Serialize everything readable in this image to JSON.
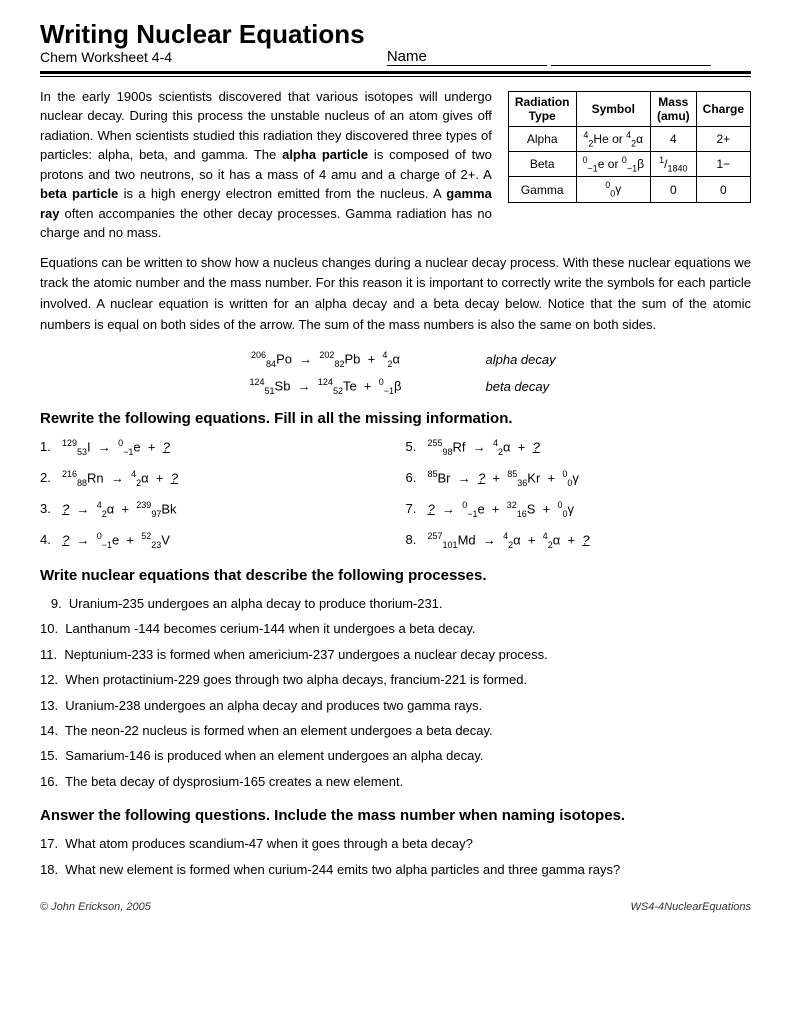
{
  "header": {
    "title": "Writing Nuclear Equations",
    "subtitle": "Chem Worksheet 4-4",
    "name_label": "Name"
  },
  "intro": {
    "paragraph1": "In the early 1900s scientists discovered that various isotopes will undergo nuclear decay. During this process the unstable nucleus of an atom gives off radiation. When scientists studied this radiation they discovered three types of particles: alpha, beta, and gamma. The ",
    "alpha_bold": "alpha particle",
    "paragraph1b": " is composed of two protons and two neutrons, so it has a mass of 4 amu and a charge of 2+. A ",
    "beta_bold": "beta particle",
    "paragraph1c": " is a high energy electron emitted from the nucleus. A ",
    "gamma_bold": "gamma ray",
    "paragraph1d": " often accompanies the other decay processes. Gamma radiation has no charge and no mass.",
    "paragraph2": "Equations can be written to show how a nucleus changes during a nuclear decay process. With these nuclear equations we track the atomic number and the mass number. For this reason it is important to correctly write the symbols for each particle involved. A nuclear equation is written for an alpha decay and a beta decay below. Notice that the sum of the atomic numbers is equal on both sides of the arrow. The sum of the mass numbers is also the same on both sides."
  },
  "radiation_table": {
    "headers": [
      "Radiation Type",
      "Symbol",
      "Mass (amu)",
      "Charge"
    ],
    "rows": [
      [
        "Alpha",
        "⁴₂He or ⁴₂α",
        "4",
        "2+"
      ],
      [
        "Beta",
        "⁰₋₁e or ⁰₋₁β",
        "1/1840",
        "1−"
      ],
      [
        "Gamma",
        "⁰₀γ",
        "0",
        "0"
      ]
    ]
  },
  "example_equations": {
    "alpha": {
      "equation": "²⁰⁶₈₄Po → ²⁰²₈₂Pb + ⁴₂α",
      "label": "alpha decay"
    },
    "beta": {
      "equation": "¹²⁴₅₁Sb → ¹²⁴₅₂Te + ⁰₋₁β",
      "label": "beta decay"
    }
  },
  "section1": {
    "title": "Rewrite the following equations. Fill in all the missing information.",
    "problems": [
      {
        "num": "1.",
        "eq": "¹²⁹₅₃I → ⁰₋₁e + ?"
      },
      {
        "num": "2.",
        "eq": "²¹⁶₈₈Rn → ⁴₂α + ?"
      },
      {
        "num": "3.",
        "eq": "? → ⁴₂α + ²³⁹₉₇Bk"
      },
      {
        "num": "4.",
        "eq": "? → ⁰₋₁e + ⁵²₂₃V"
      },
      {
        "num": "5.",
        "eq": "²⁵⁵₉₈Rf → ⁴₂α + ?"
      },
      {
        "num": "6.",
        "eq": "⁸⁵Br → ? + ⁸⁵₃₆Kr + ⁰₀γ"
      },
      {
        "num": "7.",
        "eq": "? → ⁰₋₁e + ³²₁₆S + ⁰₀γ"
      },
      {
        "num": "8.",
        "eq": "²⁵⁷₁₀₁Md → ⁴₂α + ⁴₂α + ?"
      }
    ]
  },
  "section2": {
    "title": "Write nuclear equations that describe the following processes.",
    "problems": [
      {
        "num": "9.",
        "text": "Uranium-235 undergoes an alpha decay to produce thorium-231."
      },
      {
        "num": "10.",
        "text": "Lanthanum -144 becomes cerium-144 when it undergoes a beta decay."
      },
      {
        "num": "11.",
        "text": "Neptunium-233 is formed when americium-237 undergoes a nuclear decay process."
      },
      {
        "num": "12.",
        "text": "When protactinium-229 goes through two alpha decays, francium-221 is formed."
      },
      {
        "num": "13.",
        "text": "Uranium-238 undergoes an alpha decay and produces two gamma rays."
      },
      {
        "num": "14.",
        "text": "The neon-22 nucleus is formed when an element undergoes a beta decay."
      },
      {
        "num": "15.",
        "text": "Samarium-146 is produced when an element undergoes an alpha decay."
      },
      {
        "num": "16.",
        "text": "The beta decay of dysprosium-165 creates a new element."
      }
    ]
  },
  "section3": {
    "title": "Answer the following questions. Include the mass number when naming isotopes.",
    "problems": [
      {
        "num": "17.",
        "text": "What atom produces scandium-47 when it goes through a beta decay?"
      },
      {
        "num": "18.",
        "text": "What new element is formed when curium-244 emits two alpha particles and three gamma rays?"
      }
    ]
  },
  "footer": {
    "copyright": "© John Erickson, 2005",
    "worksheet_id": "WS4-4NuclearEquations"
  }
}
